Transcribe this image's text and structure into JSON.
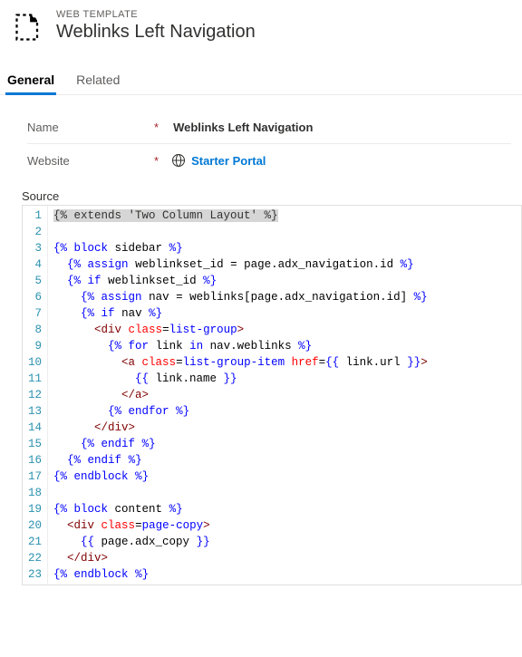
{
  "header": {
    "breadcrumb": "WEB TEMPLATE",
    "title": "Weblinks Left Navigation"
  },
  "tabs": {
    "general": "General",
    "related": "Related"
  },
  "form": {
    "name_label": "Name",
    "name_value": "Weblinks Left Navigation",
    "website_label": "Website",
    "website_value": "Starter Portal"
  },
  "source": {
    "label": "Source",
    "lines": [
      [
        {
          "c": "sel",
          "v": "{% extends 'Two Column Layout' %}"
        }
      ],
      [],
      [
        {
          "c": "t-tag",
          "v": "{%"
        },
        {
          "c": "t-text",
          "v": " "
        },
        {
          "c": "t-tag",
          "v": "block"
        },
        {
          "c": "t-text",
          "v": " sidebar "
        },
        {
          "c": "t-tag",
          "v": "%}"
        }
      ],
      [
        {
          "c": "t-text",
          "v": "  "
        },
        {
          "c": "t-tag",
          "v": "{%"
        },
        {
          "c": "t-text",
          "v": " "
        },
        {
          "c": "t-tag",
          "v": "assign"
        },
        {
          "c": "t-text",
          "v": " weblinkset_id = page.adx_navigation.id "
        },
        {
          "c": "t-tag",
          "v": "%}"
        }
      ],
      [
        {
          "c": "t-text",
          "v": "  "
        },
        {
          "c": "t-tag",
          "v": "{%"
        },
        {
          "c": "t-text",
          "v": " "
        },
        {
          "c": "t-tag",
          "v": "if"
        },
        {
          "c": "t-text",
          "v": " weblinkset_id "
        },
        {
          "c": "t-tag",
          "v": "%}"
        }
      ],
      [
        {
          "c": "t-text",
          "v": "    "
        },
        {
          "c": "t-tag",
          "v": "{%"
        },
        {
          "c": "t-text",
          "v": " "
        },
        {
          "c": "t-tag",
          "v": "assign"
        },
        {
          "c": "t-text",
          "v": " nav = weblinks[page.adx_navigation.id] "
        },
        {
          "c": "t-tag",
          "v": "%}"
        }
      ],
      [
        {
          "c": "t-text",
          "v": "    "
        },
        {
          "c": "t-tag",
          "v": "{%"
        },
        {
          "c": "t-text",
          "v": " "
        },
        {
          "c": "t-tag",
          "v": "if"
        },
        {
          "c": "t-text",
          "v": " nav "
        },
        {
          "c": "t-tag",
          "v": "%}"
        }
      ],
      [
        {
          "c": "t-text",
          "v": "      "
        },
        {
          "c": "t-html",
          "v": "<div"
        },
        {
          "c": "t-text",
          "v": " "
        },
        {
          "c": "t-attr",
          "v": "class"
        },
        {
          "c": "t-text",
          "v": "="
        },
        {
          "c": "t-attrv",
          "v": "list-group"
        },
        {
          "c": "t-html",
          "v": ">"
        }
      ],
      [
        {
          "c": "t-text",
          "v": "        "
        },
        {
          "c": "t-tag",
          "v": "{%"
        },
        {
          "c": "t-text",
          "v": " "
        },
        {
          "c": "t-tag",
          "v": "for"
        },
        {
          "c": "t-text",
          "v": " link "
        },
        {
          "c": "t-tag",
          "v": "in"
        },
        {
          "c": "t-text",
          "v": " nav.weblinks "
        },
        {
          "c": "t-tag",
          "v": "%}"
        }
      ],
      [
        {
          "c": "t-text",
          "v": "          "
        },
        {
          "c": "t-html",
          "v": "<a"
        },
        {
          "c": "t-text",
          "v": " "
        },
        {
          "c": "t-attr",
          "v": "class"
        },
        {
          "c": "t-text",
          "v": "="
        },
        {
          "c": "t-attrv",
          "v": "list-group-item"
        },
        {
          "c": "t-text",
          "v": " "
        },
        {
          "c": "t-attr",
          "v": "href"
        },
        {
          "c": "t-text",
          "v": "="
        },
        {
          "c": "t-tag",
          "v": "{{"
        },
        {
          "c": "t-text",
          "v": " link.url "
        },
        {
          "c": "t-tag",
          "v": "}}"
        },
        {
          "c": "t-html",
          "v": ">"
        }
      ],
      [
        {
          "c": "t-text",
          "v": "            "
        },
        {
          "c": "t-tag",
          "v": "{{"
        },
        {
          "c": "t-text",
          "v": " link.name "
        },
        {
          "c": "t-tag",
          "v": "}}"
        }
      ],
      [
        {
          "c": "t-text",
          "v": "          "
        },
        {
          "c": "t-html",
          "v": "</a>"
        }
      ],
      [
        {
          "c": "t-text",
          "v": "        "
        },
        {
          "c": "t-tag",
          "v": "{%"
        },
        {
          "c": "t-text",
          "v": " "
        },
        {
          "c": "t-tag",
          "v": "endfor"
        },
        {
          "c": "t-text",
          "v": " "
        },
        {
          "c": "t-tag",
          "v": "%}"
        }
      ],
      [
        {
          "c": "t-text",
          "v": "      "
        },
        {
          "c": "t-html",
          "v": "</div>"
        }
      ],
      [
        {
          "c": "t-text",
          "v": "    "
        },
        {
          "c": "t-tag",
          "v": "{%"
        },
        {
          "c": "t-text",
          "v": " "
        },
        {
          "c": "t-tag",
          "v": "endif"
        },
        {
          "c": "t-text",
          "v": " "
        },
        {
          "c": "t-tag",
          "v": "%}"
        }
      ],
      [
        {
          "c": "t-text",
          "v": "  "
        },
        {
          "c": "t-tag",
          "v": "{%"
        },
        {
          "c": "t-text",
          "v": " "
        },
        {
          "c": "t-tag",
          "v": "endif"
        },
        {
          "c": "t-text",
          "v": " "
        },
        {
          "c": "t-tag",
          "v": "%}"
        }
      ],
      [
        {
          "c": "t-tag",
          "v": "{%"
        },
        {
          "c": "t-text",
          "v": " "
        },
        {
          "c": "t-tag",
          "v": "endblock"
        },
        {
          "c": "t-text",
          "v": " "
        },
        {
          "c": "t-tag",
          "v": "%}"
        }
      ],
      [],
      [
        {
          "c": "t-tag",
          "v": "{%"
        },
        {
          "c": "t-text",
          "v": " "
        },
        {
          "c": "t-tag",
          "v": "block"
        },
        {
          "c": "t-text",
          "v": " content "
        },
        {
          "c": "t-tag",
          "v": "%}"
        }
      ],
      [
        {
          "c": "t-text",
          "v": "  "
        },
        {
          "c": "t-html",
          "v": "<div"
        },
        {
          "c": "t-text",
          "v": " "
        },
        {
          "c": "t-attr",
          "v": "class"
        },
        {
          "c": "t-text",
          "v": "="
        },
        {
          "c": "t-attrv",
          "v": "page-copy"
        },
        {
          "c": "t-html",
          "v": ">"
        }
      ],
      [
        {
          "c": "t-text",
          "v": "    "
        },
        {
          "c": "t-tag",
          "v": "{{"
        },
        {
          "c": "t-text",
          "v": " page.adx_copy "
        },
        {
          "c": "t-tag",
          "v": "}}"
        }
      ],
      [
        {
          "c": "t-text",
          "v": "  "
        },
        {
          "c": "t-html",
          "v": "</div>"
        }
      ],
      [
        {
          "c": "t-tag",
          "v": "{%"
        },
        {
          "c": "t-text",
          "v": " "
        },
        {
          "c": "t-tag",
          "v": "endblock"
        },
        {
          "c": "t-text",
          "v": " "
        },
        {
          "c": "t-tag",
          "v": "%}"
        }
      ]
    ]
  }
}
